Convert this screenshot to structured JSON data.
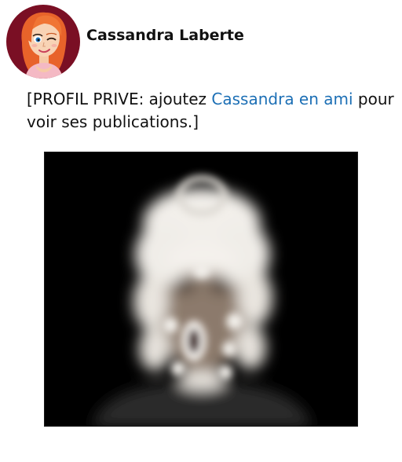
{
  "profile": {
    "name": "Cassandra Laberte",
    "avatar_icon": "cartoon-woman-avatar",
    "avatar_bg": "#7a0f24"
  },
  "notice": {
    "prefix": "[PROFIL PRIVE: ajoutez ",
    "link_text": "Cassandra en ami",
    "suffix": " pour voir ses publications.]",
    "link_color": "#1c6fb5"
  },
  "post": {
    "photo_icon": "blurred-portrait-photo",
    "photo_bg": "#000000"
  }
}
